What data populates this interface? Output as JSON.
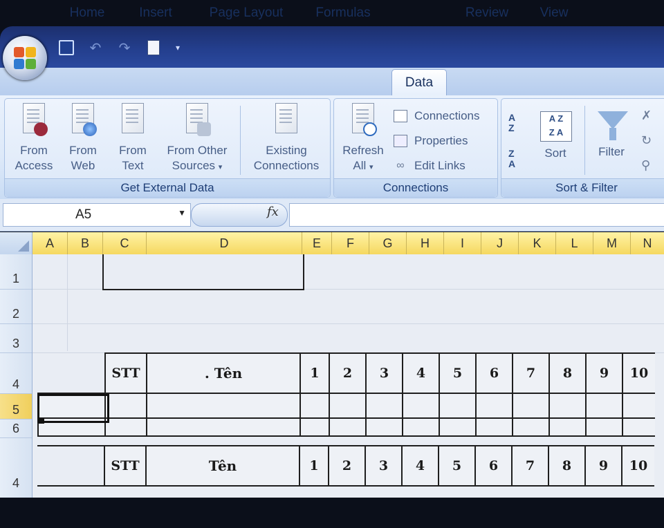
{
  "quick_access": {
    "icons": [
      "office-button-icon",
      "save-icon",
      "undo-icon",
      "redo-icon",
      "print-preview-icon",
      "customize-qat-icon"
    ]
  },
  "tabs": [
    "Home",
    "Insert",
    "Page Layout",
    "Formulas",
    "Data",
    "Review",
    "View"
  ],
  "active_tab": "Data",
  "ribbon": {
    "get_external_data": {
      "label": "Get External Data",
      "from_access": [
        "From",
        "Access"
      ],
      "from_web": [
        "From",
        "Web"
      ],
      "from_text": [
        "From",
        "Text"
      ],
      "from_other": [
        "From Other",
        "Sources"
      ],
      "existing": [
        "Existing",
        "Connections"
      ]
    },
    "connections": {
      "label": "Connections",
      "refresh": [
        "Refresh",
        "All"
      ],
      "connections": "Connections",
      "properties": "Properties",
      "edit_links": "Edit Links"
    },
    "sort_filter": {
      "label": "Sort & Filter",
      "sort": "Sort",
      "filter": "Filter",
      "az_top": "A",
      "az_bottom": "Z",
      "za_top": "Z",
      "za_bottom": "A",
      "sort_az": "A Z",
      "sort_za": "Z A"
    }
  },
  "formula_bar": {
    "name_box": "A5",
    "fx": "fx",
    "formula": ""
  },
  "columns": [
    "A",
    "B",
    "C",
    "D",
    "E",
    "F",
    "G",
    "H",
    "I",
    "J",
    "K",
    "L",
    "M",
    "N"
  ],
  "rows": [
    "1",
    "2",
    "3",
    "4",
    "5",
    "6",
    "4"
  ],
  "table_header": {
    "stt": "STT",
    "ten": "Tên",
    "ten_first": ". Tên",
    "numbers": [
      "1",
      "2",
      "3",
      "4",
      "5",
      "6",
      "7",
      "8",
      "9",
      "10"
    ]
  },
  "colors": {
    "title_bar": "#243f8e",
    "ribbon": "#dde9f9",
    "column_header": "#f5d860",
    "grid_border": "#1e1e1e"
  }
}
